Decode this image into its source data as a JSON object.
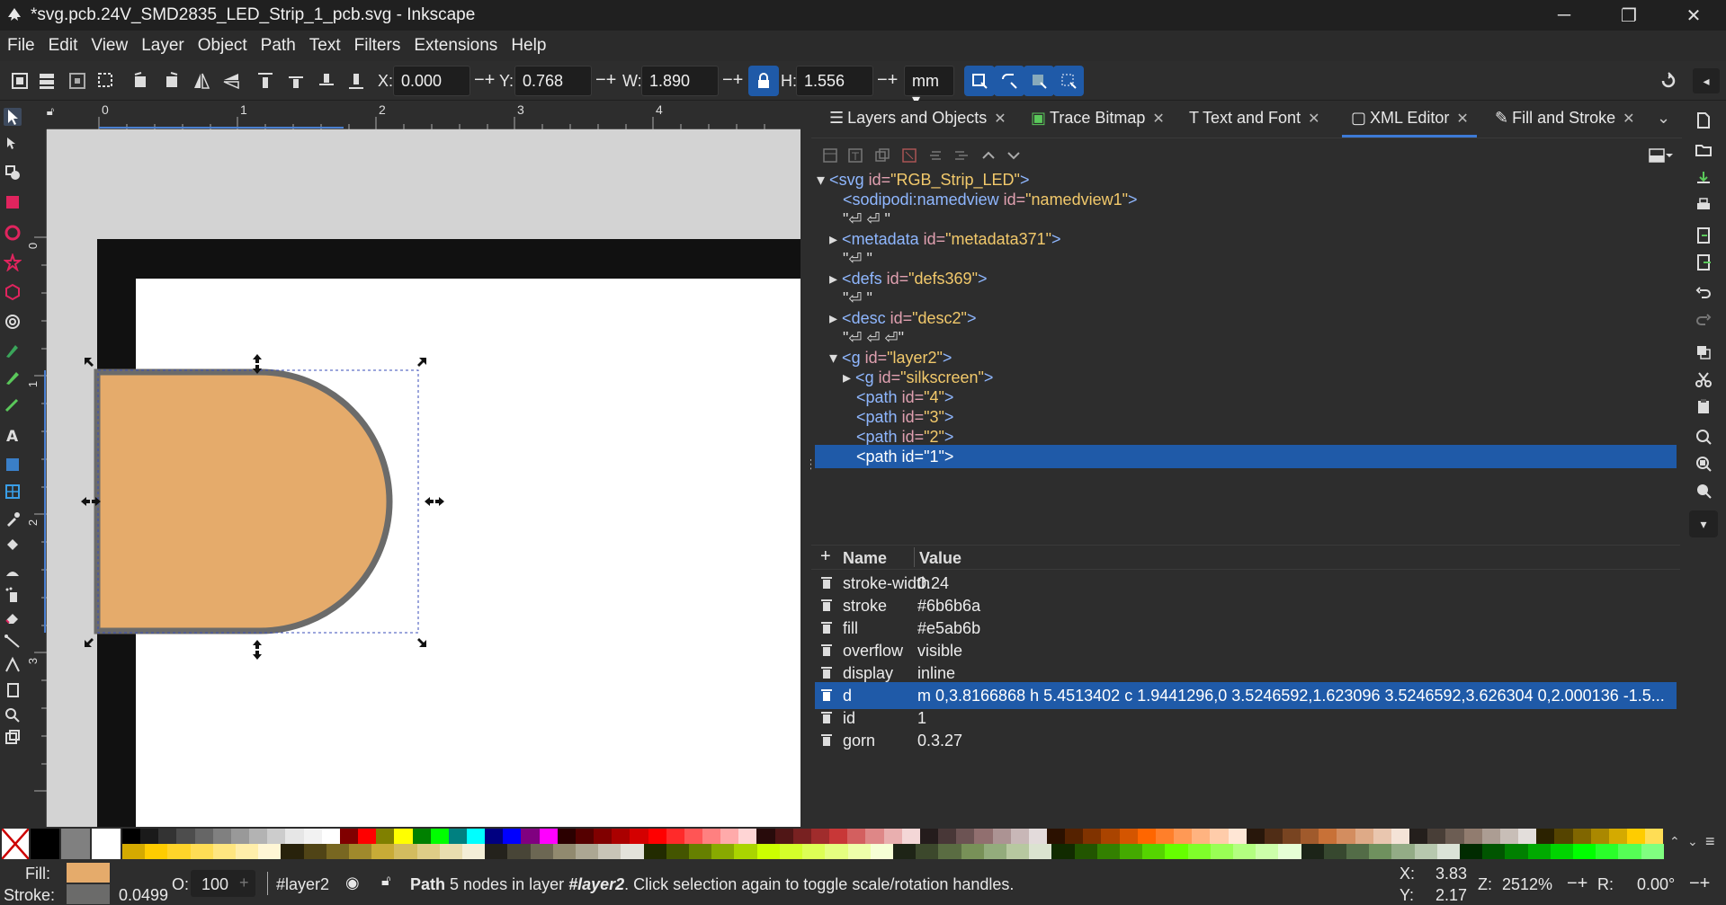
{
  "window": {
    "title": "*svg.pcb.24V_SMD2835_LED_Strip_1_pcb.svg - Inkscape"
  },
  "menu": [
    "File",
    "Edit",
    "View",
    "Layer",
    "Object",
    "Path",
    "Text",
    "Filters",
    "Extensions",
    "Help"
  ],
  "toolbar": {
    "x_label": "X:",
    "x_value": "0.000",
    "y_label": "Y:",
    "y_value": "0.768",
    "w_label": "W:",
    "w_value": "1.890",
    "h_label": "H:",
    "h_value": "1.556",
    "unit": "mm"
  },
  "ruler": {
    "top_ticks": [
      "0",
      "1",
      "2",
      "3",
      "4"
    ],
    "left_ticks": [
      "0",
      "1",
      "2",
      "3"
    ]
  },
  "dock": {
    "tabs": [
      {
        "label": "Layers and Objects",
        "icon": "layers-icon"
      },
      {
        "label": "Trace Bitmap",
        "icon": "trace-bitmap-icon"
      },
      {
        "label": "Text and Font",
        "icon": "text-icon"
      },
      {
        "label": "XML Editor",
        "icon": "xml-icon",
        "active": true
      },
      {
        "label": "Fill and Stroke",
        "icon": "fill-stroke-icon"
      }
    ]
  },
  "xml": {
    "nodes": {
      "svg": {
        "open": "<",
        "tag": "svg",
        "attr": " id=",
        "val": "\"RGB_Strip_LED\"",
        "close": ">"
      },
      "namedview": {
        "open": "<",
        "tag": "sodipodi:namedview",
        "attr": " id=",
        "val": "\"namedview1\"",
        "close": ">"
      },
      "text1": "\"⏎ ⏎ \"",
      "metadata": {
        "open": "<",
        "tag": "metadata",
        "attr": " id=",
        "val": "\"metadata371\"",
        "close": ">"
      },
      "text2": "\"⏎ \"",
      "defs": {
        "open": "<",
        "tag": "defs",
        "attr": " id=",
        "val": "\"defs369\"",
        "close": ">"
      },
      "text3": "\"⏎ \"",
      "desc": {
        "open": "<",
        "tag": "desc",
        "attr": " id=",
        "val": "\"desc2\"",
        "close": ">"
      },
      "text4": "\"⏎ ⏎ ⏎\"",
      "layer2": {
        "open": "<",
        "tag": "g",
        "attr": " id=",
        "val": "\"layer2\"",
        "close": ">"
      },
      "silkscreen": {
        "open": "<",
        "tag": "g",
        "attr": " id=",
        "val": "\"silkscreen\"",
        "close": ">"
      },
      "path4": {
        "open": "<",
        "tag": "path",
        "attr": " id=",
        "val": "\"4\"",
        "close": ">"
      },
      "path3": {
        "open": "<",
        "tag": "path",
        "attr": " id=",
        "val": "\"3\"",
        "close": ">"
      },
      "path2": {
        "open": "<",
        "tag": "path",
        "attr": " id=",
        "val": "\"2\"",
        "close": ">"
      },
      "path1": "<path id=\"1\">"
    }
  },
  "attributes": {
    "header_name": "Name",
    "header_value": "Value",
    "rows": [
      {
        "name": "stroke-width",
        "value": "0.24"
      },
      {
        "name": "stroke",
        "value": "#6b6b6a"
      },
      {
        "name": "fill",
        "value": "#e5ab6b"
      },
      {
        "name": "overflow",
        "value": "visible"
      },
      {
        "name": "display",
        "value": "inline"
      },
      {
        "name": "d",
        "value": "m 0,3.8166868 h 5.4513402 c 1.9441296,0 3.5246592,1.623096 3.5246592,3.626304 0,2.000136 -1.5...",
        "selected": true
      },
      {
        "name": "id",
        "value": "1"
      },
      {
        "name": "gorn",
        "value": "0.3.27"
      }
    ]
  },
  "status": {
    "fill_label": "Fill:",
    "stroke_label": "Stroke:",
    "stroke_width": "0.0499",
    "opacity_label": "O:",
    "opacity_value": "100",
    "layer": "#layer2",
    "msg_bold": "Path",
    "msg_1": " 5 nodes in layer ",
    "msg_layer": "#layer2",
    "msg_2": ". Click selection again to toggle scale/rotation handles.",
    "x_label": "X:",
    "x_value": "3.83",
    "y_label": "Y:",
    "y_value": "2.17",
    "zoom_label": "Z:",
    "zoom_value": "2512%",
    "rot_label": "R:",
    "rot_value": "0.00°"
  },
  "colors": {
    "fill": "#e5ab6b",
    "stroke": "#6b6b6a",
    "selection": "#1f5aa8",
    "accent": "#3d7ad6"
  },
  "palette": {
    "top": [
      "#000000",
      "#1a1a1a",
      "#333333",
      "#4d4d4d",
      "#666666",
      "#808080",
      "#999999",
      "#b3b3b3",
      "#cccccc",
      "#e6e6e6",
      "#f2f2f2",
      "#ffffff",
      "#800000",
      "#ff0000",
      "#808000",
      "#ffff00",
      "#008000",
      "#00ff00",
      "#008080",
      "#00ffff",
      "#000080",
      "#0000ff",
      "#800080",
      "#ff00ff",
      "#2b0000",
      "#550000",
      "#800000",
      "#aa0000",
      "#d40000",
      "#ff0000",
      "#ff2a2a",
      "#ff5555",
      "#ff8080",
      "#ffaaaa",
      "#ffd5d5",
      "#280b0b",
      "#501616",
      "#782121",
      "#a02c2c",
      "#c83737",
      "#d35f5f",
      "#de8787",
      "#e9afaf",
      "#f4d7d7",
      "#241c1c",
      "#483737",
      "#6c5353",
      "#916f6f",
      "#ac9393",
      "#c8b7b7",
      "#e3dbdb",
      "#2b1100",
      "#552200",
      "#803300",
      "#aa4400",
      "#d45500",
      "#ff6600",
      "#ff7f2a",
      "#ff9955",
      "#ffb380",
      "#ffccaa",
      "#ffe6d5",
      "#28170b",
      "#502d16",
      "#784421",
      "#a05a2c",
      "#c87137",
      "#d38d5f",
      "#deaa87",
      "#e9c6af",
      "#f4e3d7",
      "#241f1c",
      "#483e37",
      "#6c5d53",
      "#917c6f",
      "#ac9d93",
      "#c8beb7",
      "#e3dedb",
      "#2b2200",
      "#554400",
      "#806600",
      "#aa8800",
      "#d4aa00",
      "#ffcc00",
      "#ffdd55"
    ],
    "bottom": [
      "#d4aa00",
      "#ffcc00",
      "#ffd42a",
      "#ffdd55",
      "#ffe680",
      "#ffeeaa",
      "#fff6d5",
      "#28220b",
      "#504416",
      "#786721",
      "#a0892c",
      "#c8ab37",
      "#d3bc5f",
      "#decd87",
      "#e9ddaf",
      "#f4eed7",
      "#24221c",
      "#484537",
      "#6c6753",
      "#918a6f",
      "#aca793",
      "#c8c4b7",
      "#e3e2db",
      "#222b00",
      "#445500",
      "#668000",
      "#88aa00",
      "#aad400",
      "#ccff00",
      "#d4ff2a",
      "#ddff55",
      "#e5ff80",
      "#eeffaa",
      "#f6ffd5",
      "#1e2416",
      "#3c482c",
      "#5a6c42",
      "#789158",
      "#93ac7c",
      "#b7c8a0",
      "#dbe3d0",
      "#112b00",
      "#225500",
      "#338000",
      "#44aa00",
      "#55d400",
      "#66ff00",
      "#7fff2a",
      "#99ff55",
      "#b3ff80",
      "#ccffaa",
      "#e5ffd5",
      "#1c2418",
      "#37482f",
      "#536c47",
      "#6f915e",
      "#93ac86",
      "#b7c8ae",
      "#dbe3d7",
      "#002b00",
      "#005500",
      "#008000",
      "#00aa00",
      "#00d400",
      "#00ff00",
      "#2aff2a",
      "#55ff55",
      "#80ff80"
    ]
  }
}
